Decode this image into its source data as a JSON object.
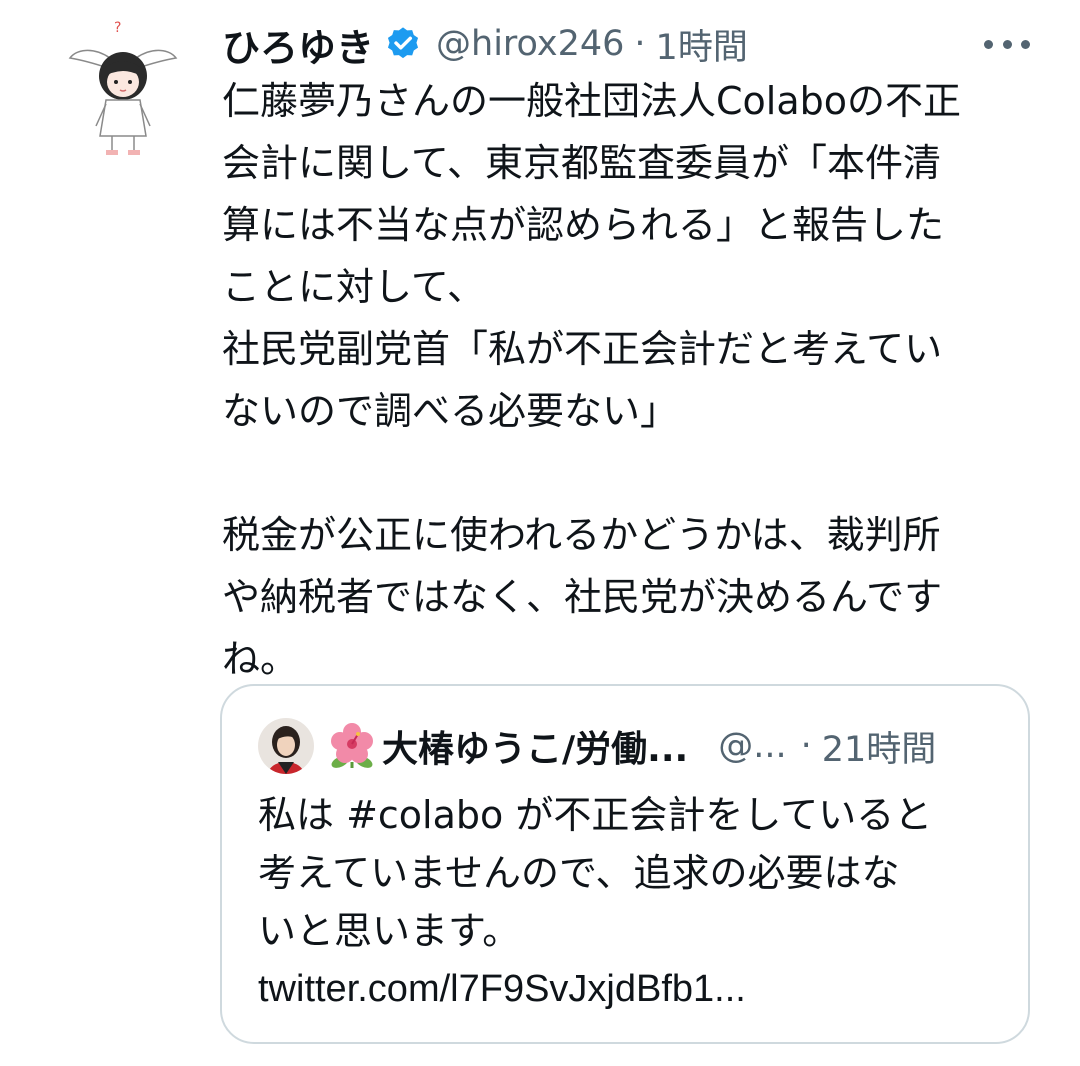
{
  "tweet": {
    "author_name": "ひろゆき",
    "handle": "@hirox246",
    "separator": "·",
    "time": "1時間",
    "body_lines": [
      "仁藤夢乃さんの一般社団法人Colaboの不正",
      "会計に関して、東京都監査委員が「本件清",
      "算には不当な点が認められる」と報告した",
      "ことに対して、",
      "社民党副党首「私が不正会計だと考えてい",
      "ないので調べる必要ない」",
      "",
      "税金が公正に使われるかどうかは、裁判所",
      "や納税者ではなく、社民党が決めるんです",
      "ね。"
    ]
  },
  "quoted_tweet": {
    "author_name": "大椿ゆうこ/労働...",
    "handle": "@...",
    "separator": "·",
    "time": "21時間",
    "body_lines": [
      "私は #colabo が不正会計をしていると",
      "考えていませんので、追求の必要はな",
      "いと思います。"
    ],
    "link": "twitter.com/l7F9SvJxjdBfb1..."
  },
  "icons": {
    "verified": "verified-badge-icon",
    "more": "more-options-icon",
    "flower": "hibiscus-emoji-icon"
  },
  "colors": {
    "primary_text": "#0f1419",
    "secondary_text": "#536471",
    "verified_blue": "#1d9bf0",
    "border": "#cfd9de"
  }
}
